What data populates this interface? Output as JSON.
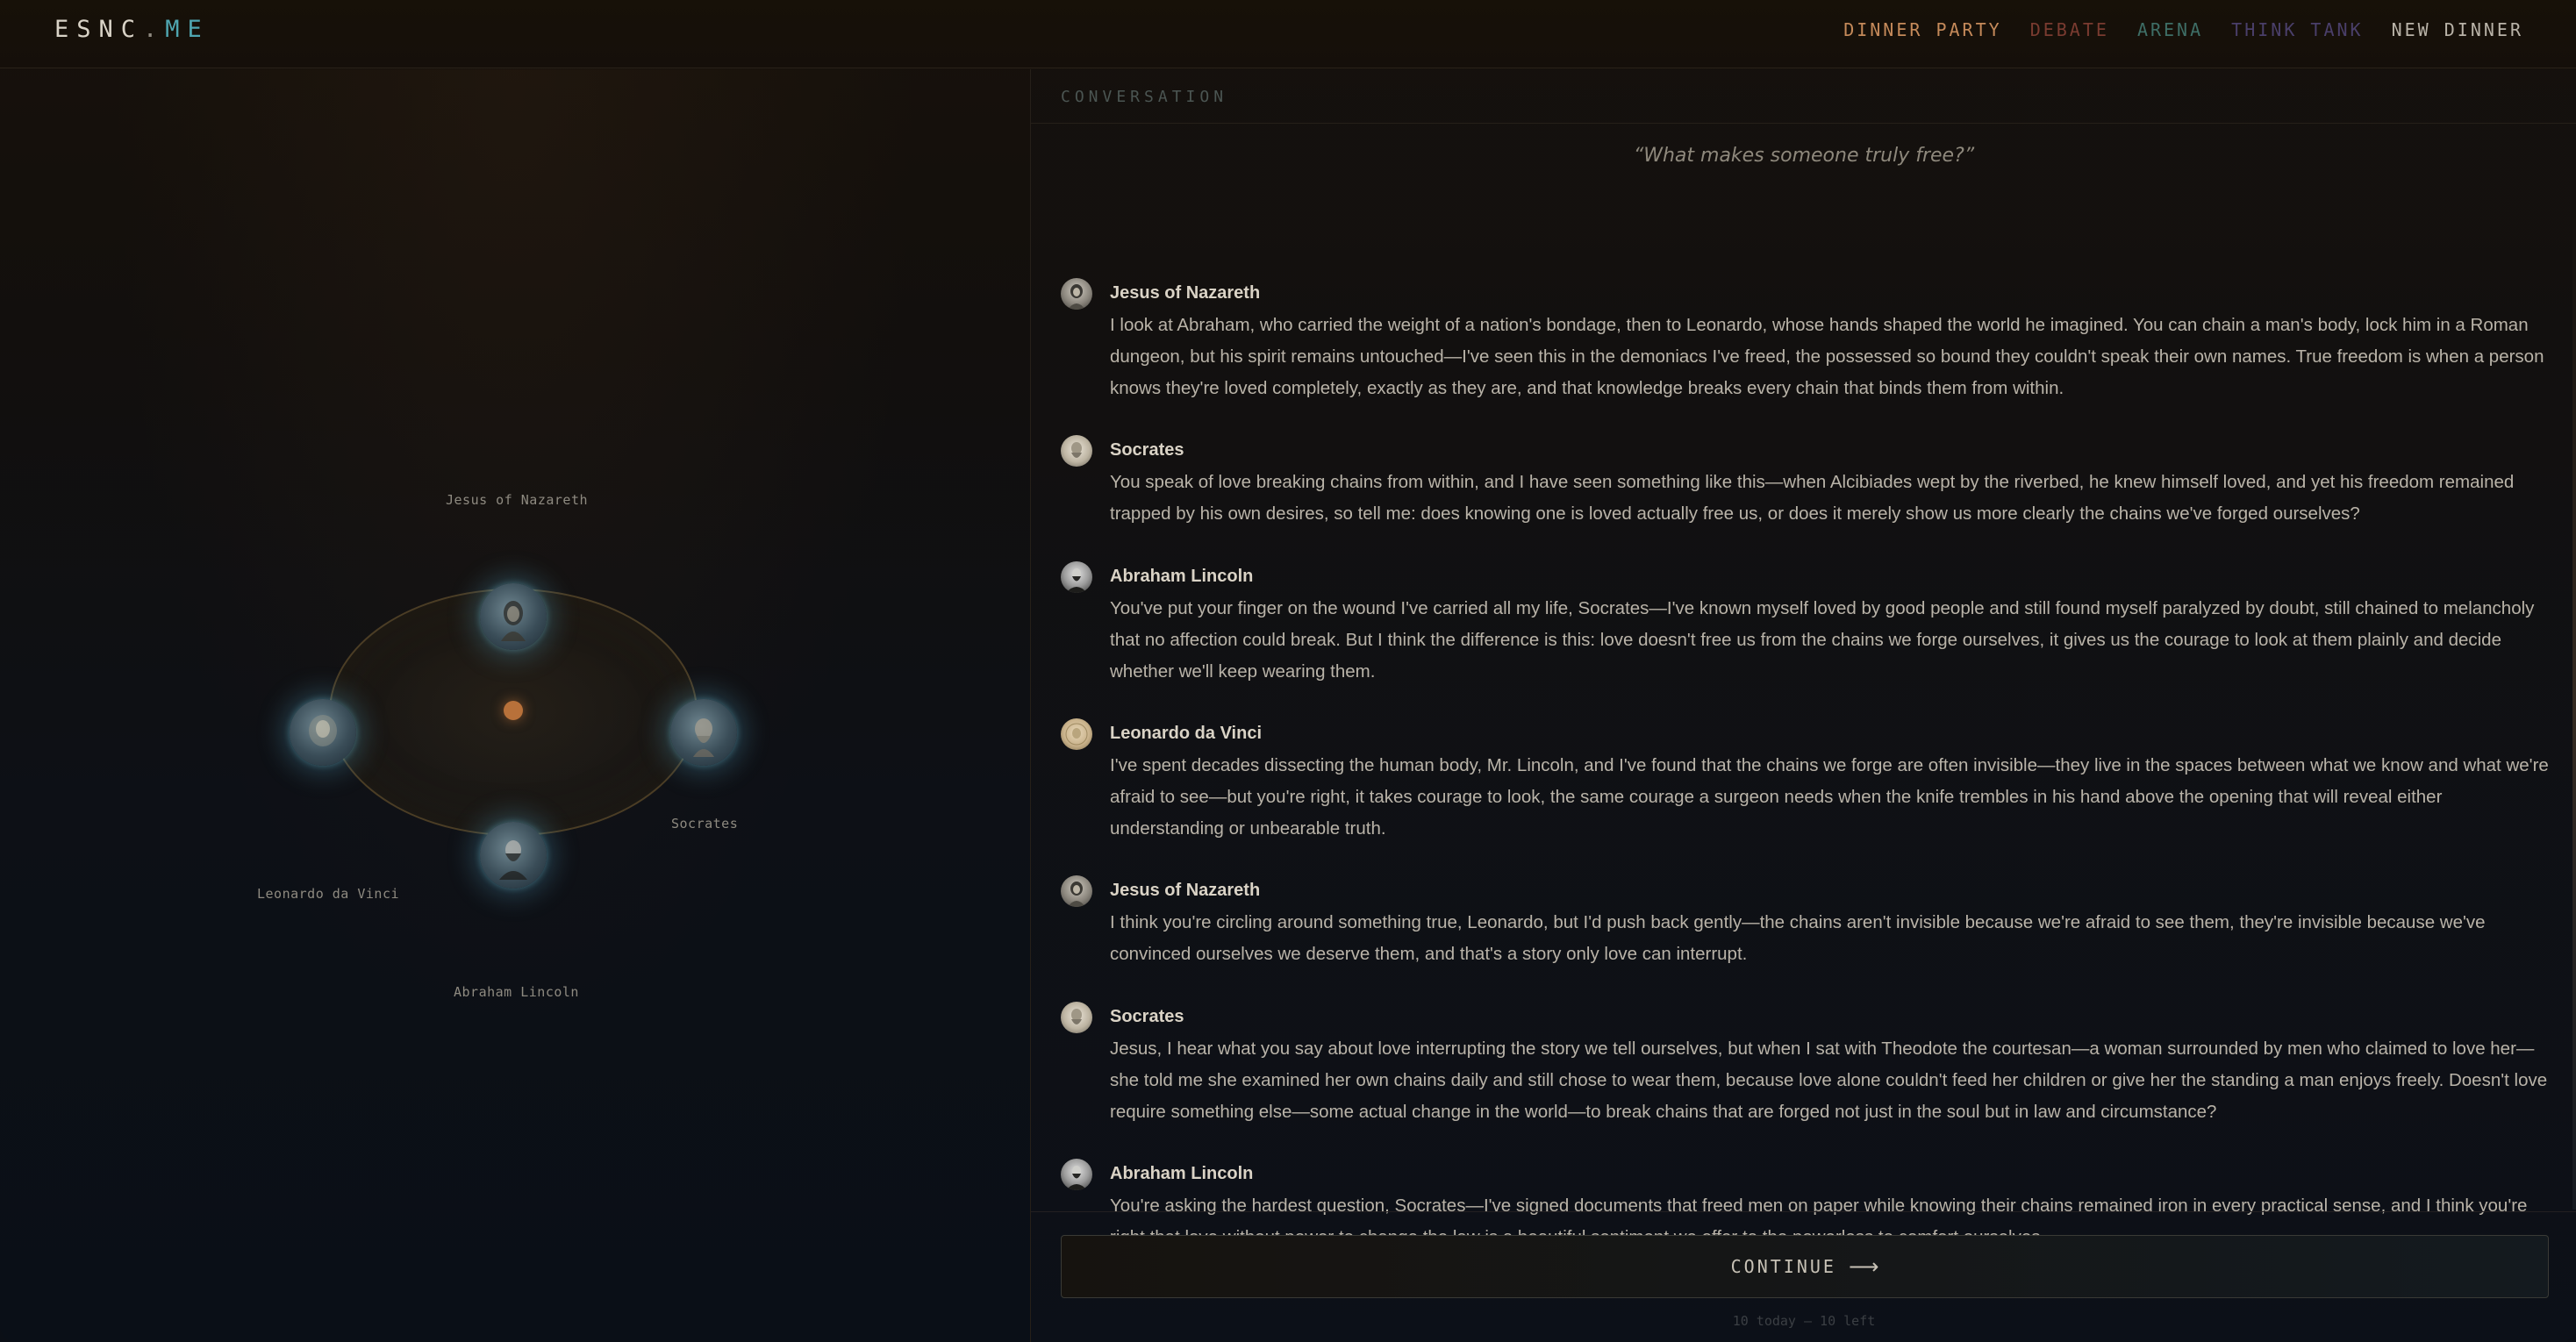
{
  "nav": {
    "logo_main": "ESNC",
    "logo_dot": ".",
    "logo_suffix": "ME",
    "links": [
      {
        "label": "DINNER PARTY",
        "color": "#c58a5a"
      },
      {
        "label": "DEBATE",
        "color": "#7a3b30"
      },
      {
        "label": "ARENA",
        "color": "#3e6e66"
      },
      {
        "label": "THINK TANK",
        "color": "#4a3f6a"
      },
      {
        "label": "NEW DINNER",
        "color": "#b9b3a8"
      }
    ]
  },
  "table": {
    "guests": [
      {
        "name": "Jesus of Nazareth",
        "icon": "portrait-jesus-icon"
      },
      {
        "name": "Socrates",
        "icon": "portrait-socrates-icon"
      },
      {
        "name": "Abraham Lincoln",
        "icon": "portrait-lincoln-icon"
      },
      {
        "name": "Leonardo da Vinci",
        "icon": "portrait-leonardo-icon"
      }
    ]
  },
  "conversation": {
    "header": "CONVERSATION",
    "topic": "“What makes someone truly free?”",
    "messages": [
      {
        "speaker": "Jesus of Nazareth",
        "avatar": "jesus",
        "text": "I look at Abraham, who carried the weight of a nation's bondage, then to Leonardo, whose hands shaped the world he imagined. You can chain a man's body, lock him in a Roman dungeon, but his spirit remains untouched—I've seen this in the demoniacs I've freed, the possessed so bound they couldn't speak their own names. True freedom is when a person knows they're loved completely, exactly as they are, and that knowledge breaks every chain that binds them from within."
      },
      {
        "speaker": "Socrates",
        "avatar": "socrates",
        "text": "You speak of love breaking chains from within, and I have seen something like this—when Alcibiades wept by the riverbed, he knew himself loved, and yet his freedom remained trapped by his own desires, so tell me: does knowing one is loved actually free us, or does it merely show us more clearly the chains we've forged ourselves?"
      },
      {
        "speaker": "Abraham Lincoln",
        "avatar": "lincoln",
        "text": "You've put your finger on the wound I've carried all my life, Socrates—I've known myself loved by good people and still found myself paralyzed by doubt, still chained to melancholy that no affection could break. But I think the difference is this: love doesn't free us from the chains we forge ourselves, it gives us the courage to look at them plainly and decide whether we'll keep wearing them."
      },
      {
        "speaker": "Leonardo da Vinci",
        "avatar": "leonardo",
        "text": "I've spent decades dissecting the human body, Mr. Lincoln, and I've found that the chains we forge are often invisible—they live in the spaces between what we know and what we're afraid to see—but you're right, it takes courage to look, the same courage a surgeon needs when the knife trembles in his hand above the opening that will reveal either understanding or unbearable truth."
      },
      {
        "speaker": "Jesus of Nazareth",
        "avatar": "jesus",
        "text": "I think you're circling around something true, Leonardo, but I'd push back gently—the chains aren't invisible because we're afraid to see them, they're invisible because we've convinced ourselves we deserve them, and that's a story only love can interrupt."
      },
      {
        "speaker": "Socrates",
        "avatar": "socrates",
        "text": "Jesus, I hear what you say about love interrupting the story we tell ourselves, but when I sat with Theodote the courtesan—a woman surrounded by men who claimed to love her—she told me she examined her own chains daily and still chose to wear them, because love alone couldn't feed her children or give her the standing a man enjoys freely. Doesn't love require something else—some actual change in the world—to break chains that are forged not just in the soul but in law and circumstance?"
      },
      {
        "speaker": "Abraham Lincoln",
        "avatar": "lincoln",
        "text": "You're asking the hardest question, Socrates—I've signed documents that freed men on paper while knowing their chains remained iron in every practical sense, and I think you're right that love without power to change the law is a beautiful sentiment we offer to the powerless to comfort ourselves."
      }
    ]
  },
  "footer": {
    "continue_label": "CONTINUE",
    "arrow": "⟶",
    "quota": "10 today — 10 left"
  }
}
